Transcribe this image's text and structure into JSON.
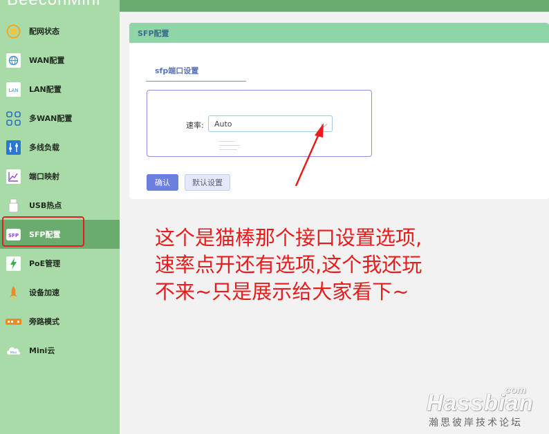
{
  "sidebar": {
    "brand": "BeeconMini",
    "items": [
      {
        "label": "配网状态",
        "icon": "sun-status-icon"
      },
      {
        "label": "WAN配置",
        "icon": "globe-icon"
      },
      {
        "label": "LAN配置",
        "icon": "lan-icon"
      },
      {
        "label": "多WAN配置",
        "icon": "grid-icon"
      },
      {
        "label": "多线负载",
        "icon": "sliders-icon"
      },
      {
        "label": "端口映射",
        "icon": "chart-line-icon"
      },
      {
        "label": "USB热点",
        "icon": "usb-icon"
      },
      {
        "label": "SFP配置",
        "icon": "sfp-icon",
        "active": true
      },
      {
        "label": "PoE管理",
        "icon": "lightning-icon"
      },
      {
        "label": "设备加速",
        "icon": "rocket-icon"
      },
      {
        "label": "旁路模式",
        "icon": "switch-icon"
      },
      {
        "label": "Mini云",
        "icon": "cloud-icon"
      }
    ]
  },
  "panel": {
    "title": "SFP配置",
    "subtab": "sfp端口设置",
    "rate_label": "速率:",
    "rate_value": "Auto",
    "confirm_button": "确认",
    "default_button": "默认设置"
  },
  "annotation": {
    "lines": [
      "这个是猫棒那个接口设置选项,",
      "速率点开还有选项,这个我还玩",
      "不来~只是展示给大家看下~"
    ],
    "color": "#e81c1c"
  },
  "watermark": {
    "com": "com",
    "main": "Hassbian",
    "sub": "瀚思彼岸技术论坛"
  },
  "colors": {
    "sidebar": "#a9dba8",
    "active": "#6aab6e",
    "panel_header": "#90d5a8",
    "primary_button": "#6b7fe0"
  }
}
